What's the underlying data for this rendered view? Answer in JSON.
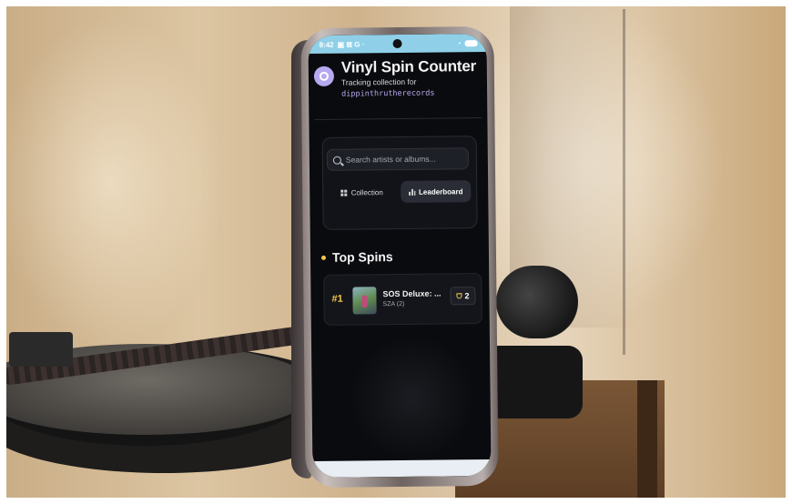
{
  "status_bar": {
    "time": "8:42",
    "icons": "▣ ⊠ G ·"
  },
  "app": {
    "title": "Vinyl Spin Counter",
    "subtitle": "Tracking collection for",
    "username": "dippinthrutherecords",
    "icon": "vinyl-record-icon"
  },
  "search": {
    "placeholder": "Search artists or albums..."
  },
  "tabs": [
    {
      "label": "Collection",
      "icon": "grid-icon",
      "active": false
    },
    {
      "label": "Leaderboard",
      "icon": "bar-chart-icon",
      "active": true
    }
  ],
  "section": {
    "title": "Top Spins"
  },
  "leaderboard": [
    {
      "rank": "#1",
      "album": "SOS Deluxe: ...",
      "artist": "SZA (2)",
      "spins": "2"
    }
  ],
  "colors": {
    "accent": "#b7a9f0",
    "gold": "#f2c84b",
    "status_bar": "#8fd0e8",
    "background": "#0a0b0e"
  }
}
